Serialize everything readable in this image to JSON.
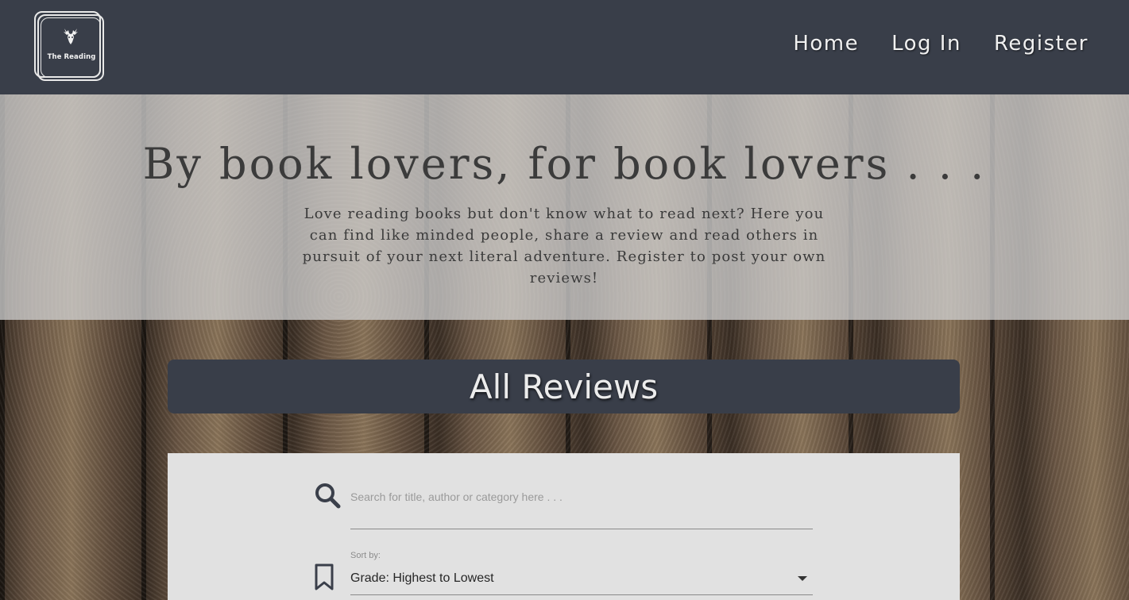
{
  "brand": {
    "logo_text": "The Reading",
    "logo_icon": "deer-head-icon"
  },
  "nav": {
    "items": [
      {
        "label": "Home"
      },
      {
        "label": "Log In"
      },
      {
        "label": "Register"
      }
    ]
  },
  "hero": {
    "title": "By book lovers, for book lovers . . .",
    "text": "Love reading books but don't know what to read next? Here you can find like minded people, share a review and read others in pursuit of your next literal adventure. Register to post your own reviews!"
  },
  "reviews": {
    "title": "All Reviews"
  },
  "search": {
    "placeholder": "Search for title, author or category here . . .",
    "value": "",
    "icon": "search-icon"
  },
  "sort": {
    "label": "Sort by:",
    "selected": "Grade: Highest to Lowest",
    "icon": "bookmark-icon"
  },
  "colors": {
    "navbar": "#393e49",
    "hero_overlay": "#cdcdcd",
    "panel": "#e1e1e1",
    "nav_text": "#f0f0f0"
  }
}
